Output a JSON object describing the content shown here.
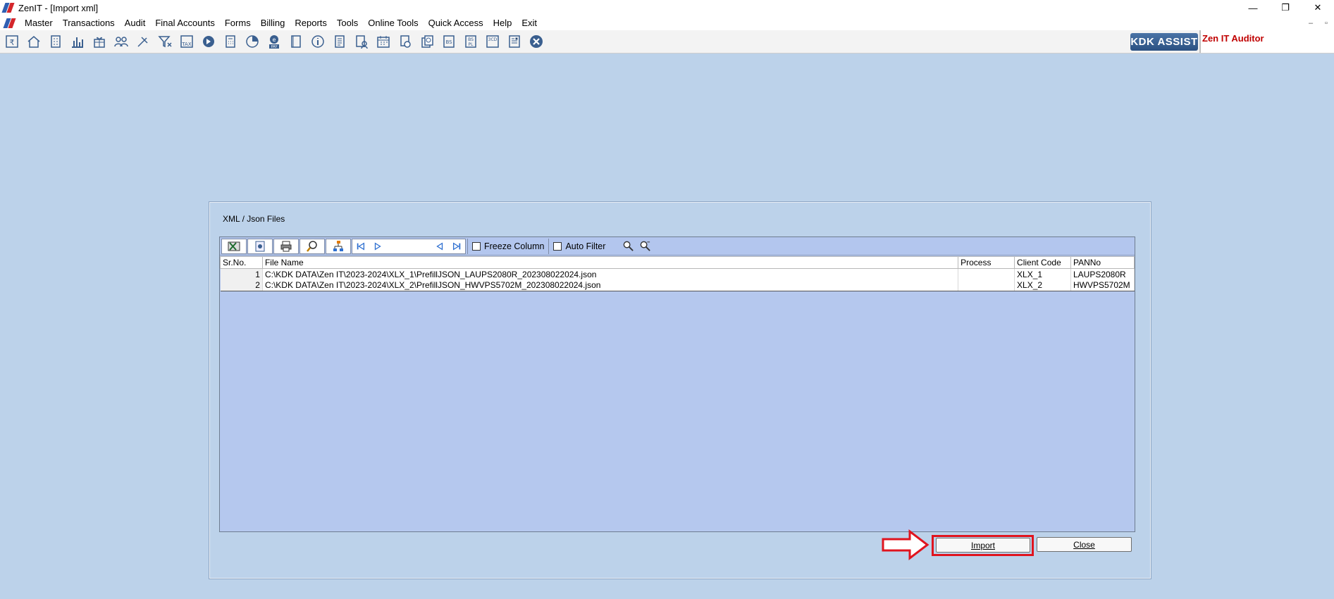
{
  "window": {
    "title": "ZenIT - [Import xml]",
    "controls": [
      "—",
      "❐",
      "✕"
    ]
  },
  "menu": {
    "items": [
      "Master",
      "Transactions",
      "Audit",
      "Final Accounts",
      "Forms",
      "Billing",
      "Reports",
      "Tools",
      "Online Tools",
      "Quick Access",
      "Help",
      "Exit"
    ]
  },
  "toolbar": {
    "icons": [
      "rupee-icon",
      "home-icon",
      "building-icon",
      "bar-chart-icon",
      "gift-icon",
      "users-icon",
      "pin-icon",
      "filter-icon",
      "tax-icon",
      "circle-arrow-icon",
      "calculator-icon",
      "pie-icon",
      "epay-icon",
      "book-icon",
      "info-icon",
      "document-icon",
      "user-document-icon",
      "calendar-icon",
      "refresh-doc-icon",
      "copy-icon",
      "bs-icon",
      "bs-pl-icon",
      "3cd-icon",
      "report-icon",
      "close-circle-icon"
    ],
    "kdk_assist": "KDK ASSIST",
    "zen_auditor": "Zen IT Auditor"
  },
  "dialog": {
    "group_label": "XML / Json Files",
    "grid_toolbar": {
      "freeze_column": "Freeze Column",
      "auto_filter": "Auto Filter"
    },
    "columns": [
      "Sr.No.",
      "File Name",
      "Process",
      "Client Code",
      "PANNo"
    ],
    "rows": [
      {
        "sr": "1",
        "file": "C:\\KDK DATA\\Zen IT\\2023-2024\\XLX_1\\PrefillJSON_LAUPS2080R_202308022024.json",
        "process": "",
        "client": "XLX_1",
        "pan": "LAUPS2080R"
      },
      {
        "sr": "2",
        "file": "C:\\KDK DATA\\Zen IT\\2023-2024\\XLX_2\\PrefillJSON_HWVPS5702M_202308022024.json",
        "process": "",
        "client": "XLX_2",
        "pan": "HWVPS5702M"
      }
    ],
    "import_button": "Import",
    "close_button": "Close"
  },
  "colors": {
    "background": "#bcd2ea",
    "grid_area": "#b5c8ee",
    "highlight": "#e0141e",
    "accent_red": "#c00000"
  }
}
